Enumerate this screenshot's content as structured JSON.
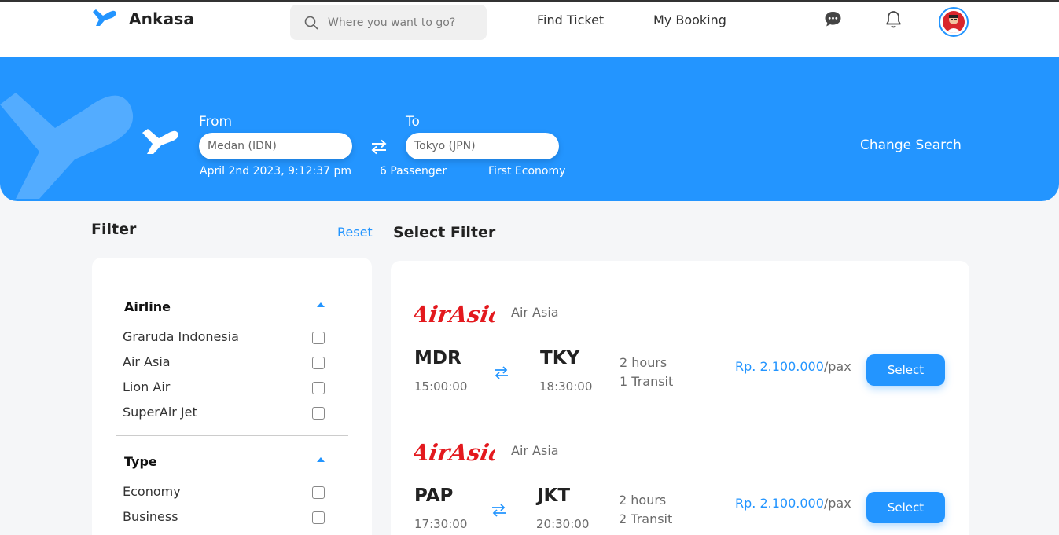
{
  "colors": {
    "accent": "#2395ff",
    "airasia_red": "#e3191e"
  },
  "brand": {
    "name": "Ankasa",
    "icon": "plane-logo-icon"
  },
  "search": {
    "placeholder": "Where you want to go?",
    "icon": "search-icon"
  },
  "nav": {
    "find_ticket": "Find Ticket",
    "my_booking": "My Booking"
  },
  "icons": {
    "chat": "chat-icon",
    "bell": "bell-icon"
  },
  "hero": {
    "from_label": "From",
    "to_label": "To",
    "from_value": "Medan (IDN)",
    "to_value": "Tokyo (JPN)",
    "date": "April 2nd 2023, 9:12:37 pm",
    "passenger": "6 Passenger",
    "class": "First Economy",
    "change_search": "Change Search"
  },
  "filter": {
    "title": "Filter",
    "reset": "Reset",
    "groups": [
      {
        "title": "Airline",
        "options": [
          "Graruda Indonesia",
          "Air Asia",
          "Lion Air",
          "SuperAir Jet"
        ]
      },
      {
        "title": "Type",
        "options": [
          "Economy",
          "Business"
        ]
      }
    ]
  },
  "results": {
    "title": "Select Filter",
    "flights": [
      {
        "logo_text": "AirAsia",
        "airline": "Air Asia",
        "from_code": "MDR",
        "from_time": "15:00:00",
        "to_code": "TKY",
        "to_time": "18:30:00",
        "duration": "2 hours",
        "transit": "1 Transit",
        "price": "Rp. 2.100.000",
        "per": "/pax",
        "select": "Select"
      },
      {
        "logo_text": "AirAsia",
        "airline": "Air Asia",
        "from_code": "PAP",
        "from_time": "17:30:00",
        "to_code": "JKT",
        "to_time": "20:30:00",
        "duration": "2 hours",
        "transit": "2 Transit",
        "price": "Rp. 2.100.000",
        "per": "/pax",
        "select": "Select"
      }
    ]
  }
}
